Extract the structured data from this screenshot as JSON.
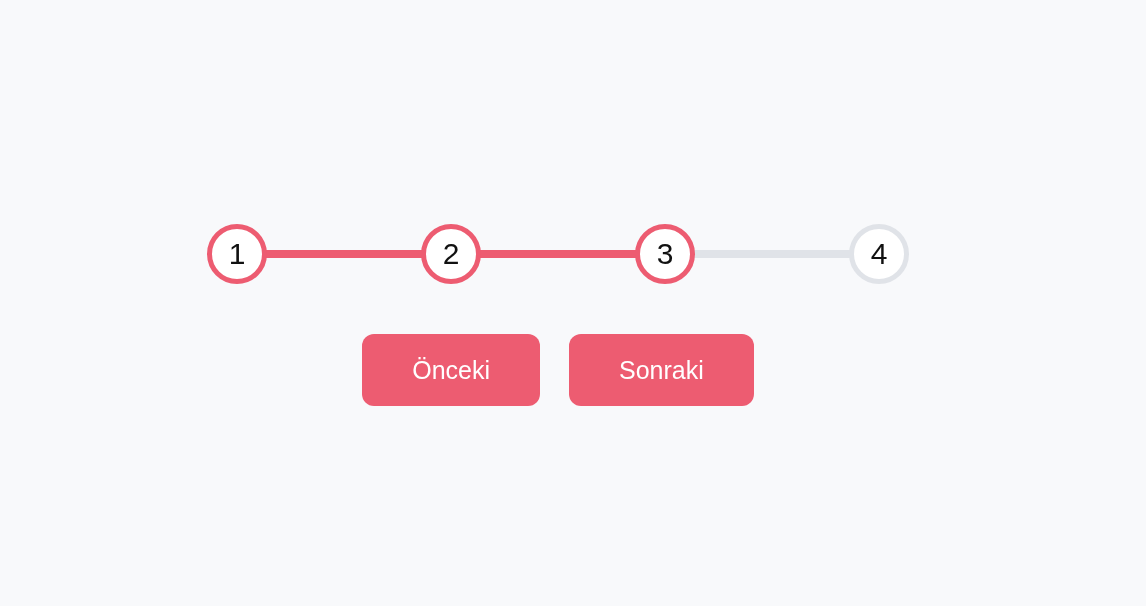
{
  "stepper": {
    "steps": [
      {
        "label": "1",
        "reached": true
      },
      {
        "label": "2",
        "reached": true
      },
      {
        "label": "3",
        "reached": true
      },
      {
        "label": "4",
        "reached": false
      }
    ]
  },
  "buttons": [
    {
      "label": "Önceki"
    },
    {
      "label": "Sonraki"
    }
  ]
}
